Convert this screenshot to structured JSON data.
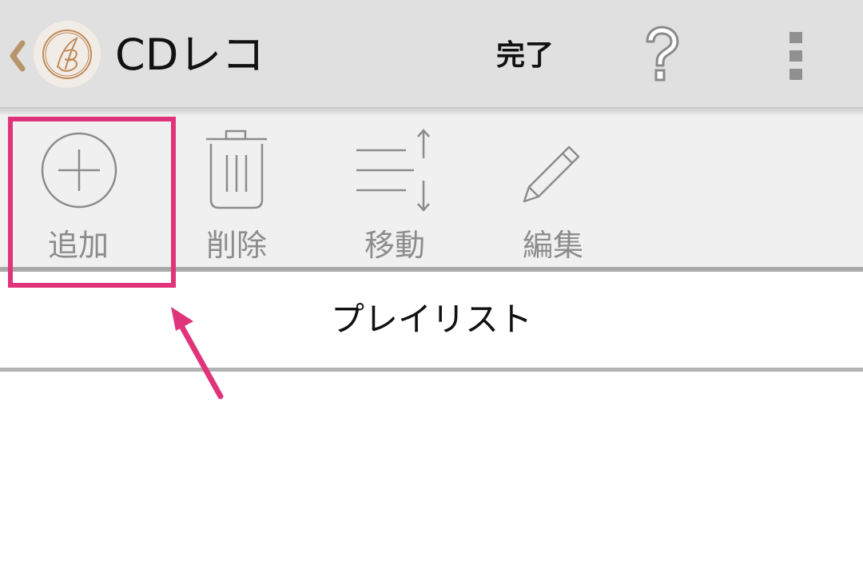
{
  "actionbar": {
    "title": "CDレコ",
    "done_label": "完了",
    "back_icon": "chevron-left-icon",
    "logo_icon": "app-logo-monogram-icon",
    "help_icon": "question-mark-icon",
    "overflow_icon": "overflow-menu-icon"
  },
  "toolbar": {
    "items": [
      {
        "label": "追加",
        "icon": "add-circle-icon"
      },
      {
        "label": "削除",
        "icon": "trash-icon"
      },
      {
        "label": "移動",
        "icon": "reorder-icon"
      },
      {
        "label": "編集",
        "icon": "pencil-icon"
      }
    ]
  },
  "section": {
    "title": "プレイリスト"
  },
  "colors": {
    "actionbar_bg": "#e0e0e0",
    "toolbar_bg": "#f0f0f0",
    "icon_gray": "#8c8c8c",
    "logo_accent": "#c08a5a",
    "back_chevron": "#b8946a",
    "annotation": "#e0347a"
  }
}
